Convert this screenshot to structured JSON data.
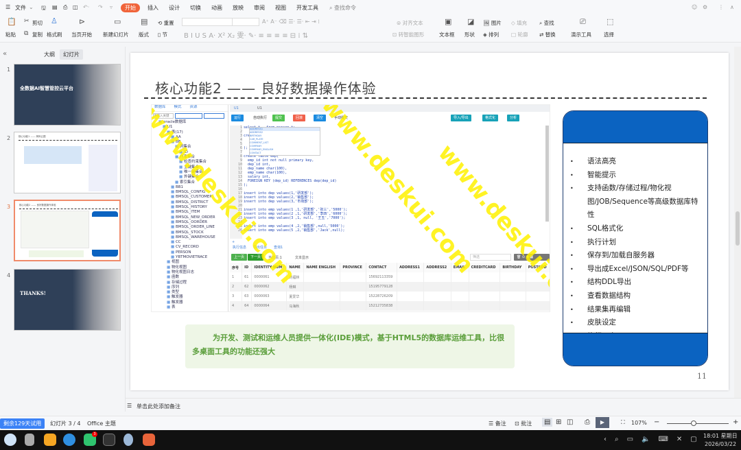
{
  "menubar": {
    "file": "文件",
    "tabs": [
      "开始",
      "插入",
      "设计",
      "切换",
      "动画",
      "放映",
      "审阅",
      "视图",
      "开发工具"
    ],
    "search": "查找命令"
  },
  "ribbon": {
    "paste": "粘贴",
    "cut": "剪切",
    "copy": "复制",
    "format_painter": "格式刷",
    "from_current": "当页开始",
    "new_slide": "新建幻灯片",
    "layout": "版式",
    "reset": "重置",
    "section": "节",
    "align_text": "对齐文本",
    "smart_art": "转智能图形",
    "textbox": "文本框",
    "shape": "形状",
    "picture": "图片",
    "arrange": "排列",
    "fill": "填充",
    "outline": "轮廓",
    "find": "查找",
    "replace": "替换",
    "present_tools": "演示工具",
    "select": "选择"
  },
  "left_panel": {
    "tab_outline": "大纲",
    "tab_slides": "幻灯片",
    "slides": [
      {
        "num": "1",
        "title": "全数据AI智慧管控云平台"
      },
      {
        "num": "2",
        "title": "核心功能1 —— 简码云图"
      },
      {
        "num": "3",
        "title": "核心功能2 —— 良好数据操作体验"
      },
      {
        "num": "4",
        "title": "THANKS!"
      }
    ]
  },
  "slide": {
    "title": "核心功能2 —— 良好数据操作体验",
    "page_number": "11",
    "description": "为开发、测试和运维人员提供一体化(IDE)模式，基于HTML5的数据库运维工具，比很多桌面工具的功能还强大",
    "features": [
      "语法高亮",
      "智能提示",
      "支持函数/存储过程/物化视图/JOB/Sequence等高级数据库特性",
      "SQL格式化",
      "执行计划",
      "保存到/加载自服务器",
      "导出成Excel/JSON/SQL/PDF等",
      "结构DDL导出",
      "查看数据结构",
      "结果集再编辑",
      "皮肤设定",
      "执行日志"
    ],
    "watermark": "www.deskui.com",
    "screenshot": {
      "tree_tabs": [
        "数据库",
        "模式",
        "资源"
      ],
      "search_placeholder": "请输入关键",
      "tree": [
        "oracle数据库",
        "U1",
        "表(17)",
        "AA",
        "BB",
        "列集合",
        "ID",
        "约束集合",
        "检查约束集合",
        "主键集合",
        "唯一键集合",
        "外键集合",
        "索引集合",
        "BB1",
        "BMSQL_CONFIG",
        "BMSQL_CUSTOMER",
        "BMSQL_DISTRICT",
        "BMSQL_HISTORY",
        "BMSQL_ITEM",
        "BMSQL_NEW_ORDER",
        "BMSQL_OORDER",
        "BMSQL_ORDER_LINE",
        "BMSQL_STOCK",
        "BMSQL_WAREHOUSE",
        "CC",
        "CV_RECORD",
        "PERSON",
        "YBTMOVIETRACE",
        "视图",
        "物化视图",
        "物化视图日志",
        "函数",
        "存储过程",
        "序列",
        "类型",
        "触发器",
        "触发器",
        "表"
      ],
      "editor_tabs": [
        "U1",
        "U1"
      ],
      "toolbar": [
        "运行",
        "自动执行",
        "提交",
        "回滚",
        "清空",
        "手动提交",
        "导入/导出",
        "格式化",
        "分析"
      ],
      "code": [
        "select t.  from person t;",
        "",
        "create table dep(",
        "    dep_id int primary key,",
        "    dep_name char(100)",
        ");",
        "",
        "create table emp(",
        "  emp_id int not null primary key,",
        "  dep_id int,",
        "  dep_name char(100),",
        "  emp_name char(100),",
        "  salary int,",
        "  FOREIGN KEY (dep_id) REFERENCES dep(dep_id)",
        ");",
        "",
        "insert into dep values(1,'研发部');",
        "insert into dep values(2,'销售部');",
        "insert into dep values(3,'市场部');",
        "",
        "insert into emp values(1 ,1,'研发部','张三','5000');",
        "insert into emp values(2 ,1,'研发部','李四','6000');",
        "insert into emp values(3 ,1, null, '王五','7000');",
        "",
        "insert into emp values(4 ,2,'销售部',null,'5000');",
        "insert into emp values(5 ,2,'销售部','Jack',null);"
      ],
      "autocomplete": [
        "ADDRESS1",
        "ADDRESS2",
        "BIRTHDAY",
        "CAR_PLATE",
        "COMMENT_LIST",
        "COMPANY",
        "COMPANY_ENGLISH",
        "CONTACT"
      ],
      "result_tabs": [
        "执行信息",
        "导出任务",
        "查询1"
      ],
      "prev": "上一页",
      "next": "下一页",
      "current_page": "当前页:1",
      "text_display": "文本显示",
      "filter_placeholder": "筛选",
      "columns": [
        "序号",
        "ID",
        "IDENTITY NUM",
        "NAME",
        "NAME ENGLISH",
        "PROVINCE",
        "CONTACT",
        "ADDRESS1",
        "ADDRESS2",
        "EMAIL",
        "CREDITCARD",
        "BIRTHDAY",
        "POSTCOD"
      ],
      "rows": [
        [
          "1",
          "61",
          "0000061",
          "刘福林",
          "",
          "",
          "15692113359"
        ],
        [
          "2",
          "62",
          "0000062",
          "杨琳",
          "",
          "",
          "15195779128"
        ],
        [
          "3",
          "63",
          "0000063",
          "夏爱华",
          "",
          "",
          "15228726209"
        ],
        [
          "4",
          "64",
          "0000064",
          "马海秋",
          "",
          "",
          "15212735838"
        ]
      ]
    }
  },
  "notes": {
    "placeholder": "单击此处添加备注"
  },
  "status": {
    "trial": "剩余129天试用",
    "slide_pos": "幻灯片 3 / 4",
    "theme": "Office 主题",
    "notes": "备注",
    "comment": "批注",
    "zoom": "107%"
  },
  "taskbar": {
    "time": "18:01 星期日",
    "date": "2026/03/22",
    "badge": "3"
  },
  "colors": {
    "accent": "#f0643a",
    "phone_blue": "#0b63c1",
    "green_text": "#5a9e3a",
    "trial_blue": "#3b82f6"
  }
}
